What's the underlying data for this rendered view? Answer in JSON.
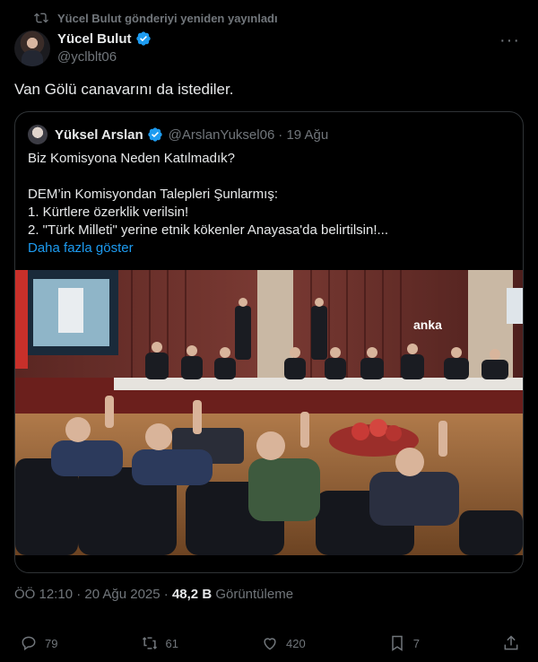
{
  "repost": {
    "text": "Yücel Bulut gönderiyi yeniden yayınladı",
    "icon": "repost-icon"
  },
  "post": {
    "author_name": "Yücel Bulut",
    "handle": "@yclblt06",
    "text": "Van Gölü canavarını da istediler.",
    "more_icon": "more-icon",
    "more_label": "···"
  },
  "quote": {
    "author_name": "Yüksel Arslan",
    "handle": "@ArslanYuksel06",
    "date": "· 19 Ağu",
    "lines": [
      "Biz Komisyona Neden Katılmadık?",
      "",
      "DEM’in Komisyondan Talepleri Şunlarmış:",
      "1. Kürtlere özerklik verilsin!",
      "2. \"Türk Milleti\" yerine etnik kökenler Anayasa'da belirtilsin!..."
    ],
    "show_more": "Daha fazla göster",
    "watermark": "anka"
  },
  "meta": {
    "time": "ÖÖ 12:10 · 20 Ağu 2025 · ",
    "views": "48,2 B",
    "views_label": " Görüntüleme"
  },
  "actions": {
    "replies": "79",
    "reposts": "61",
    "likes": "420",
    "bookmarks": "7"
  },
  "colors": {
    "accent": "#1d9bf0",
    "muted": "#71767b",
    "text": "#e7e9ea",
    "border": "#2f3336"
  }
}
